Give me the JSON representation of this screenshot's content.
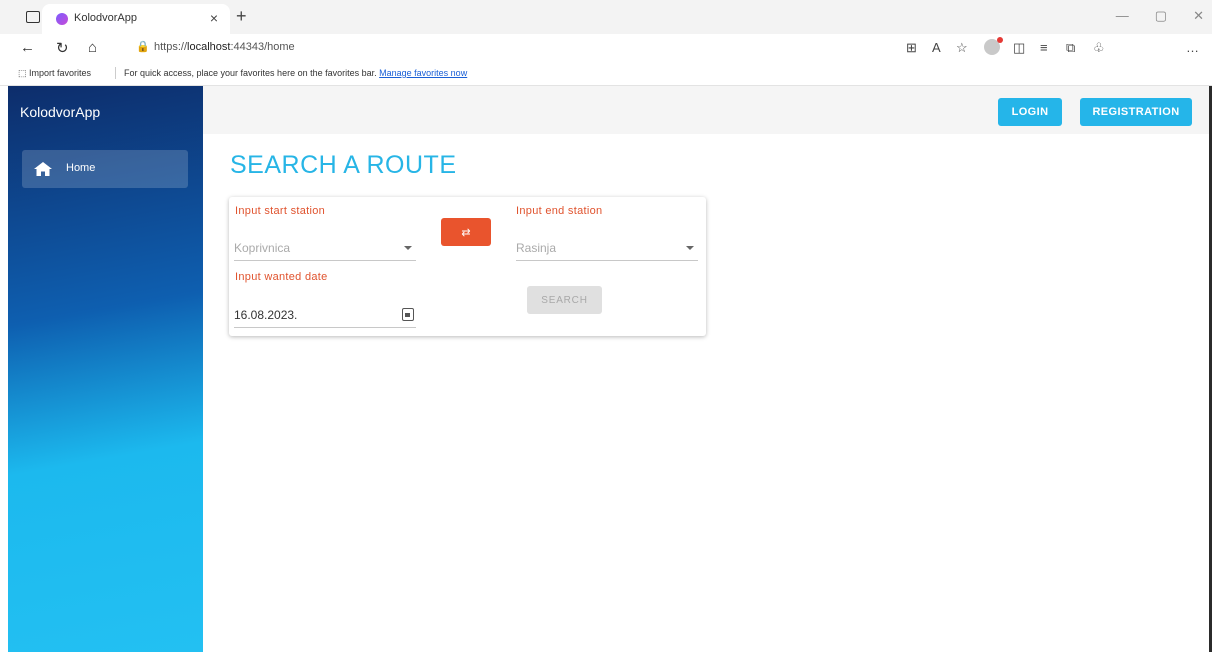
{
  "browser": {
    "tab_title": "KolodvorApp",
    "tab_close": "×",
    "new_tab": "+",
    "url_prefix": "https://",
    "url_host": "localhost",
    "url_rest": ":44343/home",
    "favbar_import": "Import favorites",
    "favbar_text": "For quick access, place your favorites here on the favorites bar.",
    "favbar_link": "Manage favorites now"
  },
  "app": {
    "title": "KolodvorApp",
    "nav": [
      {
        "label": "Home",
        "icon": "home-icon"
      }
    ],
    "login_label": "LOGIN",
    "registration_label": "REGISTRATION"
  },
  "search": {
    "heading": "SEARCH A ROUTE",
    "start_label": "Input start station",
    "start_value": "Koprivnica",
    "end_label": "Input end station",
    "end_value": "Rasinja",
    "date_label": "Input wanted date",
    "date_value": "16.08.2023.",
    "swap_glyph": "⇄",
    "search_label": "SEARCH"
  },
  "colors": {
    "accent": "#27b5e6",
    "label": "#e0532e",
    "swap": "#e9542d"
  }
}
